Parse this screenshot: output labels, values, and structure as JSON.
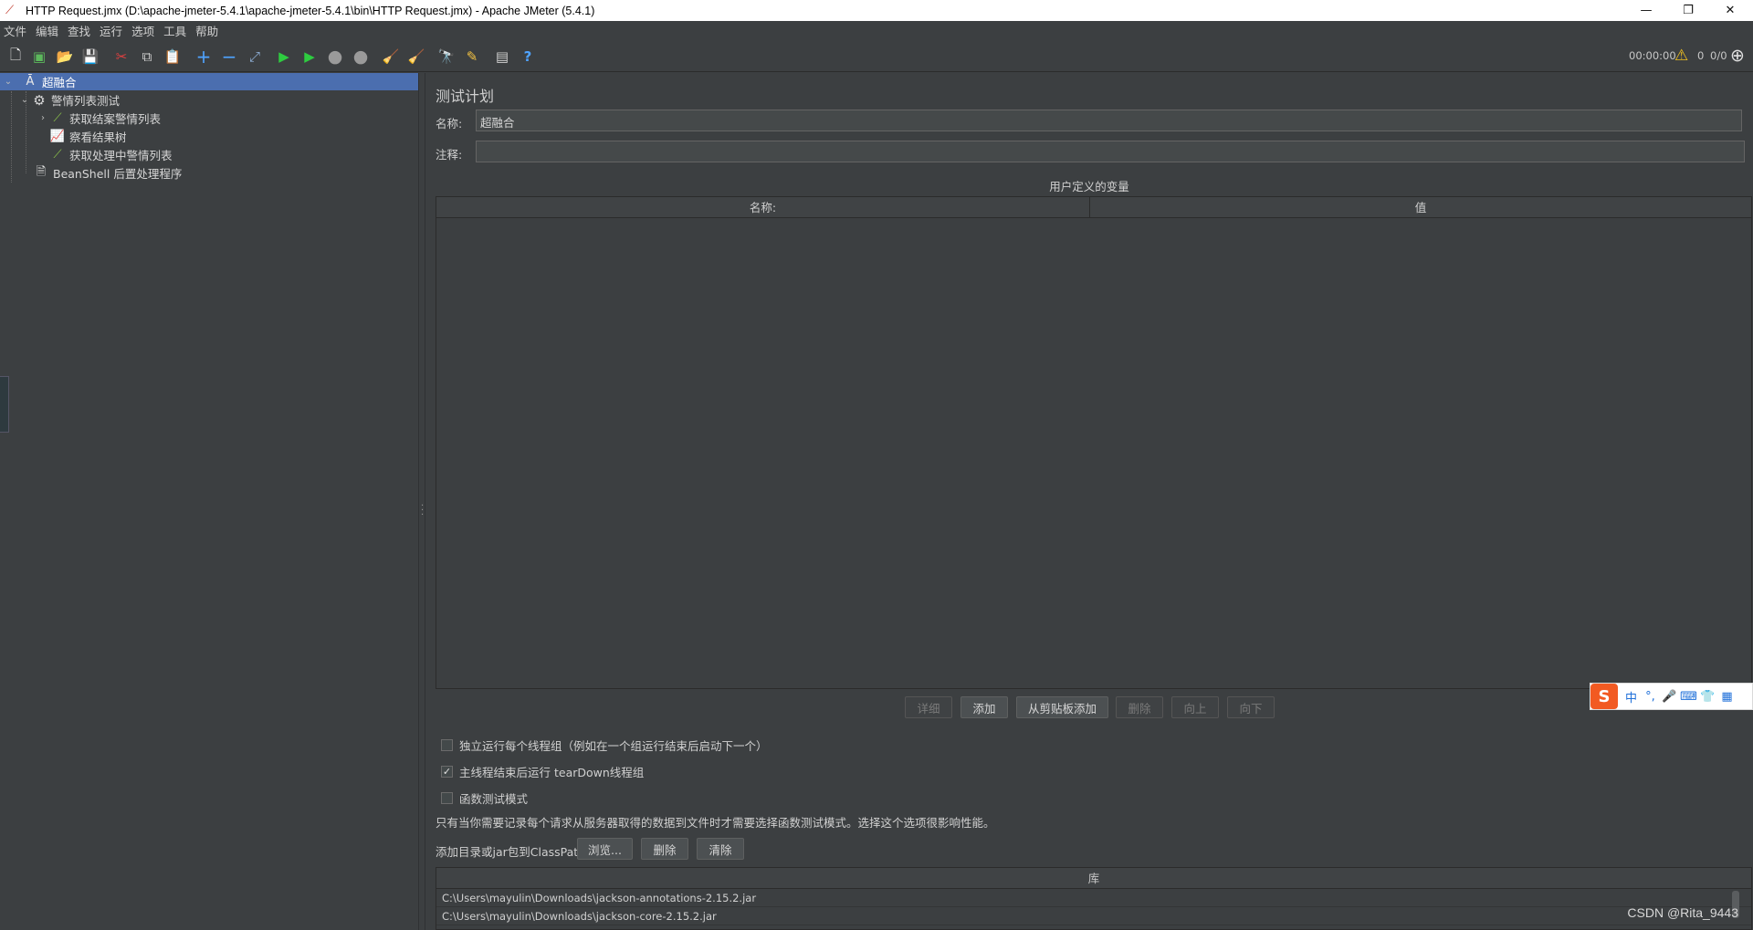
{
  "window": {
    "title": "HTTP Request.jmx (D:\\apache-jmeter-5.4.1\\apache-jmeter-5.4.1\\bin\\HTTP Request.jmx) - Apache JMeter (5.4.1)",
    "minimize": "—",
    "restore": "❐",
    "close": "✕"
  },
  "menu": [
    "文件",
    "编辑",
    "查找",
    "运行",
    "选项",
    "工具",
    "帮助"
  ],
  "toolbar": {
    "timer": "00:00:00",
    "warning_count": "0",
    "threads": "0/0"
  },
  "tree": [
    {
      "label": "超融合",
      "icon": "test-plan-icon",
      "depth": 0,
      "expanded": true,
      "selected": true
    },
    {
      "label": "警情列表测试",
      "icon": "thread-group-icon",
      "depth": 1,
      "expanded": true
    },
    {
      "label": "获取结案警情列表",
      "icon": "sampler-icon",
      "depth": 2,
      "collapsed": true
    },
    {
      "label": "察看结果树",
      "icon": "listener-icon",
      "depth": 2
    },
    {
      "label": "获取处理中警情列表",
      "icon": "sampler-icon",
      "depth": 2
    },
    {
      "label": "BeanShell 后置处理程序",
      "icon": "postprocessor-icon",
      "depth": 1
    }
  ],
  "panel": {
    "title": "测试计划",
    "name_label": "名称:",
    "name_value": "超融合",
    "comment_label": "注释:",
    "comment_value": "",
    "vars_title": "用户定义的变量",
    "columns": [
      "名称:",
      "值"
    ],
    "buttons": [
      {
        "label": "详细",
        "enabled": false
      },
      {
        "label": "添加",
        "enabled": true
      },
      {
        "label": "从剪贴板添加",
        "enabled": true
      },
      {
        "label": "删除",
        "enabled": false
      },
      {
        "label": "向上",
        "enabled": false
      },
      {
        "label": "向下",
        "enabled": false
      }
    ],
    "checkboxes": [
      {
        "label": "独立运行每个线程组（例如在一个组运行结束后启动下一个）",
        "checked": false
      },
      {
        "label": "主线程结束后运行 tearDown线程组",
        "checked": true
      },
      {
        "label": "函数测试模式",
        "checked": false
      }
    ],
    "functional_note": "只有当你需要记录每个请求从服务器取得的数据到文件时才需要选择函数测试模式。选择这个选项很影响性能。",
    "classpath_label": "添加目录或jar包到ClassPath",
    "classpath_buttons": [
      "浏览...",
      "删除",
      "清除"
    ],
    "lib_header": "库",
    "libs": [
      "C:\\Users\\mayulin\\Downloads\\jackson-annotations-2.15.2.jar",
      "C:\\Users\\mayulin\\Downloads\\jackson-core-2.15.2.jar"
    ]
  },
  "ime": {
    "logo": "S",
    "items": [
      "中",
      "°,",
      "🎤",
      "⌨",
      "👕",
      "▦"
    ]
  },
  "watermark": "CSDN @Rita_9443",
  "colors": {
    "background": "#3c3f41",
    "selection": "#4b6eaf",
    "ime_brand": "#f25a22"
  }
}
